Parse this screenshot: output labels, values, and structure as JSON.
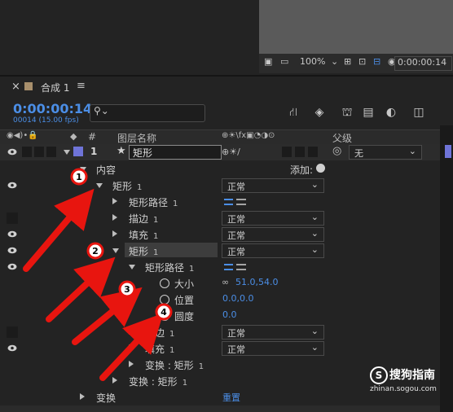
{
  "viewer": {
    "zoom": "100%",
    "timecode_small": "0:00:00:14"
  },
  "tab": {
    "close": "×",
    "name": "合成 1",
    "menu": "≡"
  },
  "timecode": "0:00:00:14",
  "fps": "00014 (15.00 fps)",
  "search_placeholder": "",
  "header": {
    "num": "#",
    "layer_name": "图层名称",
    "parent": "父级"
  },
  "layer": {
    "number": "1",
    "name": "矩形",
    "parent": "无"
  },
  "contents": {
    "label": "内容",
    "add": "添加:"
  },
  "rows": [
    {
      "name": "矩形",
      "num": "1",
      "mode": "正常"
    },
    {
      "name": "矩形路径",
      "num": "1"
    },
    {
      "name": "描边",
      "num": "1",
      "mode": "正常"
    },
    {
      "name": "填充",
      "num": "1",
      "mode": "正常"
    },
    {
      "name": "矩形",
      "num": "1",
      "mode": "正常"
    },
    {
      "name": "矩形路径",
      "num": "1"
    },
    {
      "name": "大小",
      "value": "51.0,54.0"
    },
    {
      "name": "位置",
      "value": "0.0,0.0"
    },
    {
      "name": "圆度",
      "value": "0.0"
    },
    {
      "name": "描边",
      "num": "1",
      "mode": "正常"
    },
    {
      "name": "填充",
      "num": "1",
      "mode": "正常"
    },
    {
      "name": "变换 : 矩形",
      "num": "1"
    },
    {
      "name": "变换 : 矩形",
      "num": "1"
    },
    {
      "name": "变换",
      "value": "重置"
    }
  ],
  "markers": [
    "1",
    "2",
    "3",
    "4"
  ],
  "watermark": {
    "title": "搜狗指南",
    "url": "zhinan.sogou.com"
  },
  "colors": {
    "accent": "#4b8ee6",
    "arrow": "#e8150f",
    "label": "#6f74d8"
  }
}
